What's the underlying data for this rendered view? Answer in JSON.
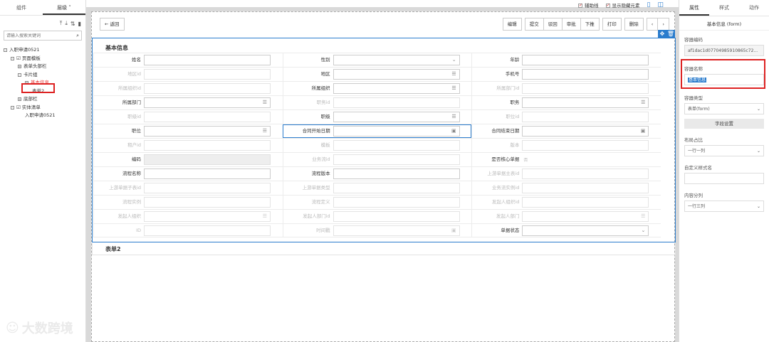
{
  "left": {
    "tabs": [
      "组件",
      "层级 ˅"
    ],
    "search_placeholder": "请输入搜索关键词",
    "tree": [
      {
        "label": "入职申请0521",
        "indent": 0,
        "box": "-"
      },
      {
        "label": "页面模板",
        "indent": 1,
        "box": "-",
        "icon": "☑"
      },
      {
        "label": "表单头部栏",
        "indent": 2,
        "box": "+"
      },
      {
        "label": "卡片组",
        "indent": 2,
        "box": "-"
      },
      {
        "label": "基本信息",
        "indent": 3,
        "box": "+",
        "selected": true
      },
      {
        "label": "表单2",
        "indent": 4,
        "box": ""
      },
      {
        "label": "底部栏",
        "indent": 2,
        "box": "+"
      },
      {
        "label": "实体清单",
        "indent": 1,
        "box": "-",
        "icon": "☑"
      },
      {
        "label": "入职申请0521",
        "indent": 3,
        "box": ""
      }
    ]
  },
  "toolbar": {
    "back": "返回",
    "buttons": [
      "编辑",
      "提交",
      "驳回",
      "审批",
      "下推",
      "打印",
      "删除",
      "‹",
      "›"
    ]
  },
  "top_checks": [
    "辅助线",
    "显示隐藏元素"
  ],
  "form": {
    "title": "基本信息",
    "rows": [
      [
        {
          "label": "姓名",
          "type": "text"
        },
        {
          "label": "性别",
          "type": "select"
        },
        {
          "label": "年龄",
          "type": "text"
        }
      ],
      [
        {
          "label": "地区id",
          "type": "text",
          "disabled": true
        },
        {
          "label": "地区",
          "type": "list"
        },
        {
          "label": "手机号",
          "type": "text"
        }
      ],
      [
        {
          "label": "所属组织id",
          "type": "text",
          "disabled": true
        },
        {
          "label": "所属组织",
          "type": "list"
        },
        {
          "label": "所属部门id",
          "type": "text",
          "disabled": true
        }
      ],
      [
        {
          "label": "所属部门",
          "type": "list"
        },
        {
          "label": "职务id",
          "type": "text",
          "disabled": true
        },
        {
          "label": "职务",
          "type": "list"
        }
      ],
      [
        {
          "label": "职级id",
          "type": "text",
          "disabled": true
        },
        {
          "label": "职级",
          "type": "list"
        },
        {
          "label": "职位id",
          "type": "text",
          "disabled": true
        }
      ],
      [
        {
          "label": "职位",
          "type": "list"
        },
        {
          "label": "合同开始日期",
          "type": "date",
          "active": true
        },
        {
          "label": "合同结束日期",
          "type": "date"
        }
      ],
      [
        {
          "label": "租户id",
          "type": "text",
          "disabled": true
        },
        {
          "label": "模板",
          "type": "text",
          "disabled": true
        },
        {
          "label": "版本",
          "type": "text",
          "disabled": true
        }
      ],
      [
        {
          "label": "编码",
          "type": "gray"
        },
        {
          "label": "业务流id",
          "type": "text",
          "disabled": true
        },
        {
          "label": "是否核心单据",
          "type": "plain",
          "value": "否"
        }
      ],
      [
        {
          "label": "流程名称",
          "type": "text"
        },
        {
          "label": "流程版本",
          "type": "text"
        },
        {
          "label": "上游单据主表id",
          "type": "text",
          "disabled": true
        }
      ],
      [
        {
          "label": "上游单据子表id",
          "type": "text",
          "disabled": true
        },
        {
          "label": "上游单据类型",
          "type": "text",
          "disabled": true
        },
        {
          "label": "业务流实例id",
          "type": "text",
          "disabled": true
        }
      ],
      [
        {
          "label": "流程实例",
          "type": "text",
          "disabled": true
        },
        {
          "label": "流程定义",
          "type": "text",
          "disabled": true
        },
        {
          "label": "发起人组织id",
          "type": "text",
          "disabled": true
        }
      ],
      [
        {
          "label": "发起人组织",
          "type": "list",
          "disabled": true
        },
        {
          "label": "发起人部门id",
          "type": "text",
          "disabled": true
        },
        {
          "label": "发起人部门",
          "type": "list",
          "disabled": true
        }
      ],
      [
        {
          "label": "ID",
          "type": "text",
          "disabled": true
        },
        {
          "label": "时间戳",
          "type": "date",
          "disabled": true
        },
        {
          "label": "单据状态",
          "type": "select"
        }
      ]
    ]
  },
  "form2": {
    "title": "表单2"
  },
  "right": {
    "tabs": [
      "属性",
      "样式",
      "动作"
    ],
    "header": "基本信息 (form)",
    "code_label": "容器编码",
    "code_value": "af1dac1d07704985910865c72...",
    "name_label": "容器名称",
    "name_value": "基本信息",
    "type_label": "容器类型",
    "type_value": "表单(form)",
    "field_btn": "字段设置",
    "layout_label": "布局占比",
    "layout_value": "一行一列",
    "style_label": "自定义样式名",
    "cols_label": "内容分列",
    "cols_value": "一行三列"
  },
  "watermark": "大数跨境"
}
